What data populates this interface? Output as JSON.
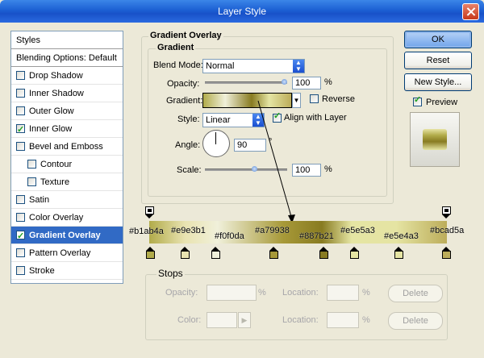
{
  "window": {
    "title": "Layer Style"
  },
  "sidebar": {
    "header": "Styles",
    "items": [
      {
        "label": "Blending Options: Default",
        "checkbox": false
      },
      {
        "label": "Drop Shadow",
        "checkbox": true,
        "checked": false
      },
      {
        "label": "Inner Shadow",
        "checkbox": true,
        "checked": false
      },
      {
        "label": "Outer Glow",
        "checkbox": true,
        "checked": false
      },
      {
        "label": "Inner Glow",
        "checkbox": true,
        "checked": true
      },
      {
        "label": "Bevel and Emboss",
        "checkbox": true,
        "checked": false
      },
      {
        "label": "Contour",
        "checkbox": true,
        "checked": false,
        "indent": true
      },
      {
        "label": "Texture",
        "checkbox": true,
        "checked": false,
        "indent": true
      },
      {
        "label": "Satin",
        "checkbox": true,
        "checked": false
      },
      {
        "label": "Color Overlay",
        "checkbox": true,
        "checked": false
      },
      {
        "label": "Gradient Overlay",
        "checkbox": true,
        "checked": true,
        "selected": true
      },
      {
        "label": "Pattern Overlay",
        "checkbox": true,
        "checked": false
      },
      {
        "label": "Stroke",
        "checkbox": true,
        "checked": false
      }
    ]
  },
  "panel": {
    "section_title": "Gradient Overlay",
    "group_title": "Gradient",
    "blend_mode_label": "Blend Mode:",
    "blend_mode_value": "Normal",
    "opacity_label": "Opacity:",
    "opacity_value": "100",
    "opacity_unit": "%",
    "gradient_label": "Gradient:",
    "reverse_label": "Reverse",
    "reverse_checked": false,
    "style_label": "Style:",
    "style_value": "Linear",
    "align_label": "Align with Layer",
    "align_checked": true,
    "angle_label": "Angle:",
    "angle_value": "90",
    "angle_unit": "°",
    "scale_label": "Scale:",
    "scale_value": "100",
    "scale_unit": "%"
  },
  "buttons": {
    "ok": "OK",
    "reset": "Reset",
    "new_style": "New Style...",
    "preview_label": "Preview",
    "preview_checked": true
  },
  "gradient_editor": {
    "color_stops": [
      {
        "label": "#b1ab4a",
        "color": "#b1ab4a"
      },
      {
        "label": "#e9e3b1",
        "color": "#e9e3b1"
      },
      {
        "label": "#f0f0da",
        "color": "#f0f0da"
      },
      {
        "label": "#a79938",
        "color": "#a79938"
      },
      {
        "label": "#887b21",
        "color": "#887b21"
      },
      {
        "label": "#e5e5a3",
        "color": "#e5e5a3"
      },
      {
        "label": "#e5e4a3",
        "color": "#e5e4a3"
      },
      {
        "label": "#bcad5a",
        "color": "#bcad5a"
      }
    ],
    "stops_title": "Stops",
    "opacity_label": "Opacity:",
    "color_label": "Color:",
    "location_label": "Location:",
    "percent": "%",
    "delete_label": "Delete"
  }
}
